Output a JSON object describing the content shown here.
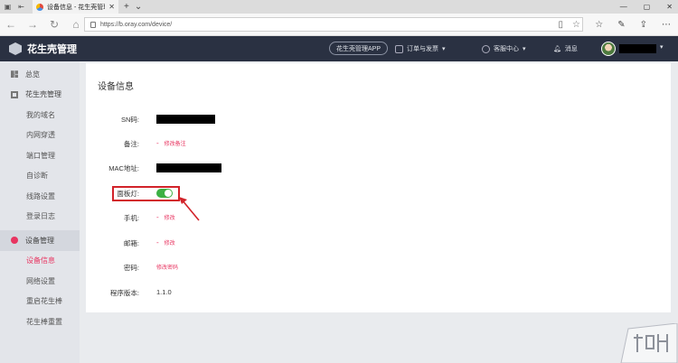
{
  "browser": {
    "tab_title": "设备信息 - 花生壳管理",
    "url": "https://b.oray.com/device/"
  },
  "header": {
    "brand": "花生壳管理",
    "app_button": "花生壳管理APP",
    "orders": "订单与发票",
    "service": "客服中心",
    "messages": "消息"
  },
  "sidebar": {
    "overview": "总览",
    "hsk_group": "花生壳管理",
    "hsk_items": [
      "我的域名",
      "内网穿透",
      "端口管理",
      "自诊断",
      "线路设置",
      "登录日志"
    ],
    "device_group": "设备管理",
    "device_items": [
      "设备信息",
      "网络设置",
      "重启花生棒",
      "花生棒重置"
    ]
  },
  "main": {
    "title": "设备信息",
    "sn_label": "SN码:",
    "note_label": "备注:",
    "note_link": "修改备注",
    "mac_label": "MAC地址:",
    "panel_light_label": "面板灯:",
    "panel_light_on": true,
    "phone_label": "手机:",
    "phone_link": "修改",
    "email_label": "邮箱:",
    "email_link": "修改",
    "password_label": "密码:",
    "password_link": "修改密码",
    "version_label": "程序版本:",
    "version_value": "1.1.0",
    "dash": "-"
  },
  "colors": {
    "accent": "#e83561",
    "toggle_on": "#3cb043",
    "header_bg": "#2a3142",
    "highlight": "#d2232a"
  }
}
